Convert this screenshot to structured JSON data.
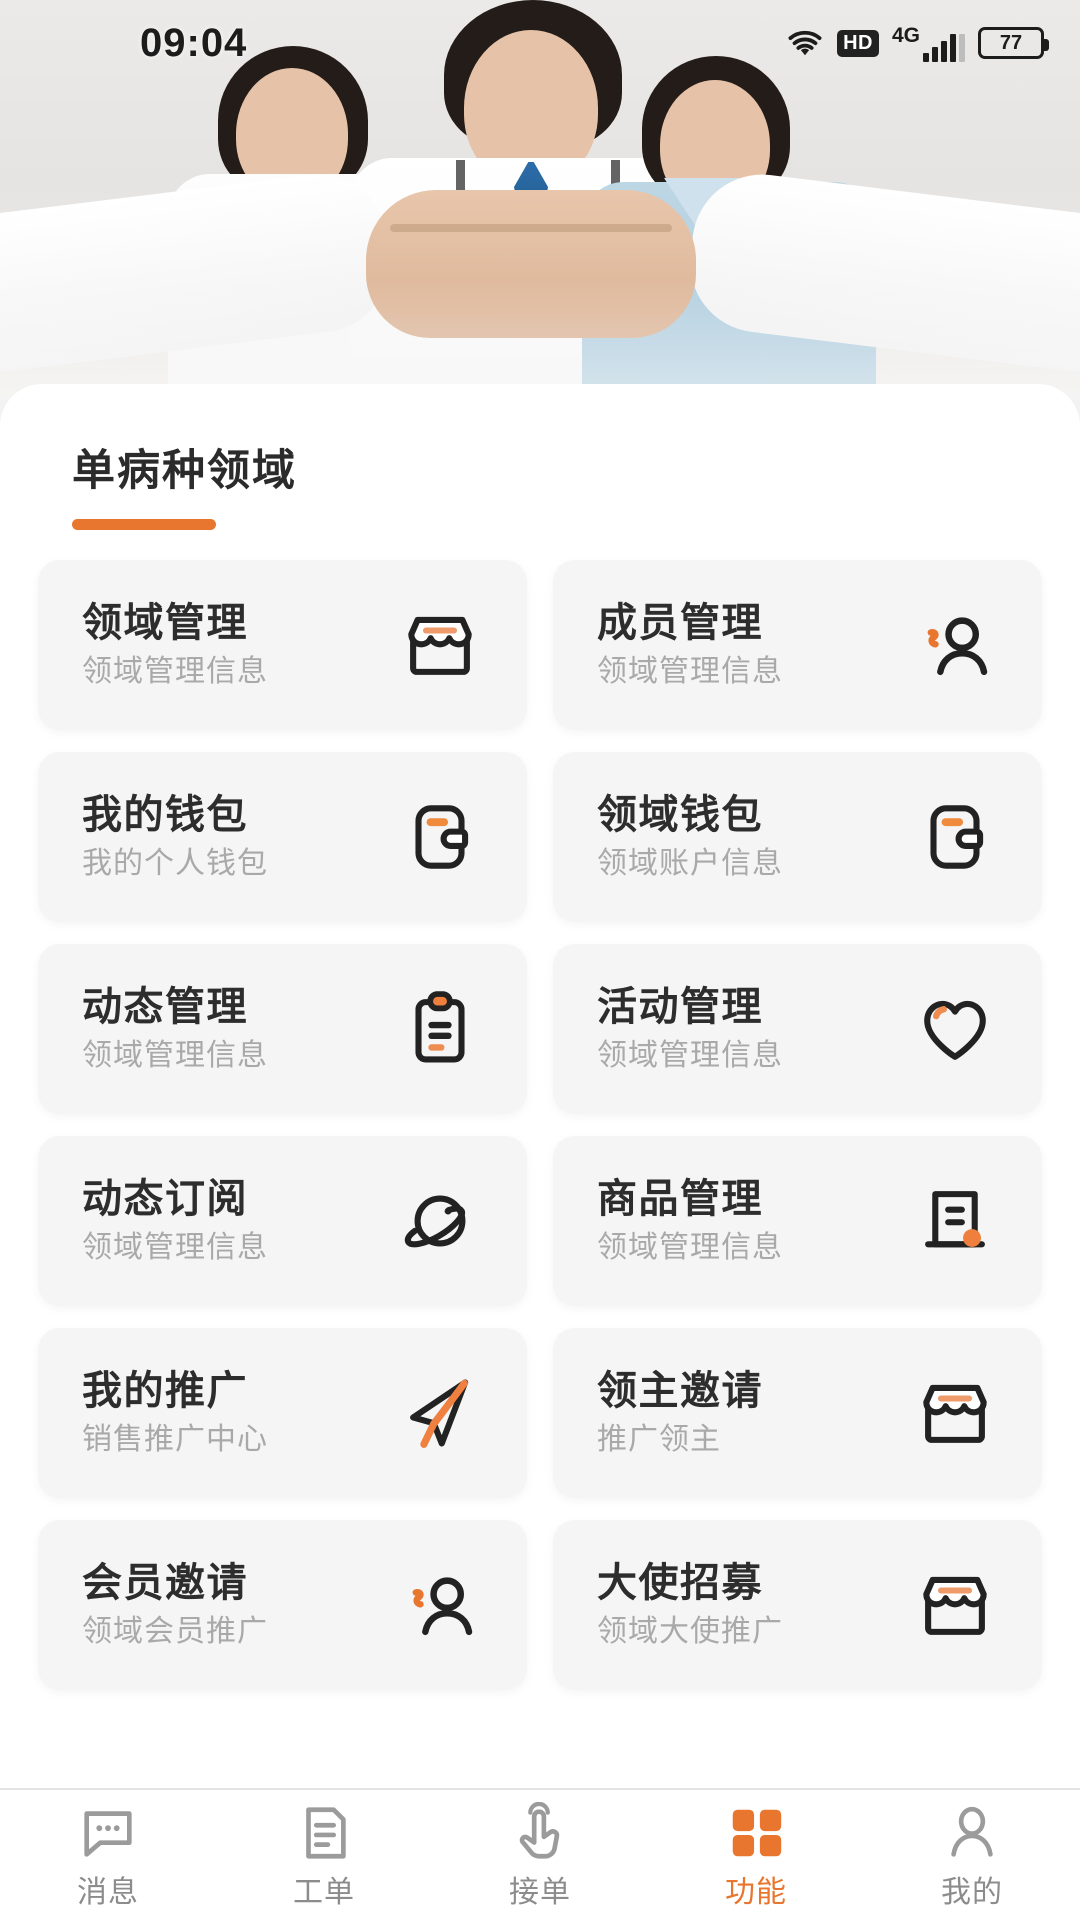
{
  "status_bar": {
    "time": "09:04",
    "wifi_icon": "wifi-icon",
    "hd_badge": "HD",
    "network": "4G",
    "signal_icon": "signal-bars-icon",
    "battery_level": "77"
  },
  "hero": {
    "name": "hero-banner-image",
    "alt": "medical team handshake banner"
  },
  "section": {
    "title": "单病种领域",
    "accent_color": "#e8762e"
  },
  "cards": [
    {
      "title": "领域管理",
      "subtitle": "领域管理信息",
      "icon": "shop-icon"
    },
    {
      "title": "成员管理",
      "subtitle": "领域管理信息",
      "icon": "user-add-icon"
    },
    {
      "title": "我的钱包",
      "subtitle": "我的个人钱包",
      "icon": "wallet-icon"
    },
    {
      "title": "领域钱包",
      "subtitle": "领域账户信息",
      "icon": "wallet-icon"
    },
    {
      "title": "动态管理",
      "subtitle": "领域管理信息",
      "icon": "clipboard-icon"
    },
    {
      "title": "活动管理",
      "subtitle": "领域管理信息",
      "icon": "heart-icon"
    },
    {
      "title": "动态订阅",
      "subtitle": "领域管理信息",
      "icon": "planet-icon"
    },
    {
      "title": "商品管理",
      "subtitle": "领域管理信息",
      "icon": "document-icon"
    },
    {
      "title": "我的推广",
      "subtitle": "销售推广中心",
      "icon": "send-icon"
    },
    {
      "title": "领主邀请",
      "subtitle": "推广领主",
      "icon": "shop-icon"
    },
    {
      "title": "会员邀请",
      "subtitle": "领域会员推广",
      "icon": "user-add-icon"
    },
    {
      "title": "大使招募",
      "subtitle": "领域大使推广",
      "icon": "shop-icon"
    }
  ],
  "tabbar": {
    "items": [
      {
        "label": "消息",
        "icon": "chat-icon",
        "active": false
      },
      {
        "label": "工单",
        "icon": "order-icon",
        "active": false
      },
      {
        "label": "接单",
        "icon": "tap-hand-icon",
        "active": false
      },
      {
        "label": "功能",
        "icon": "grid-icon",
        "active": true
      },
      {
        "label": "我的",
        "icon": "person-icon",
        "active": false
      }
    ],
    "active_color": "#e8762e",
    "inactive_color": "#8c8c8c"
  }
}
